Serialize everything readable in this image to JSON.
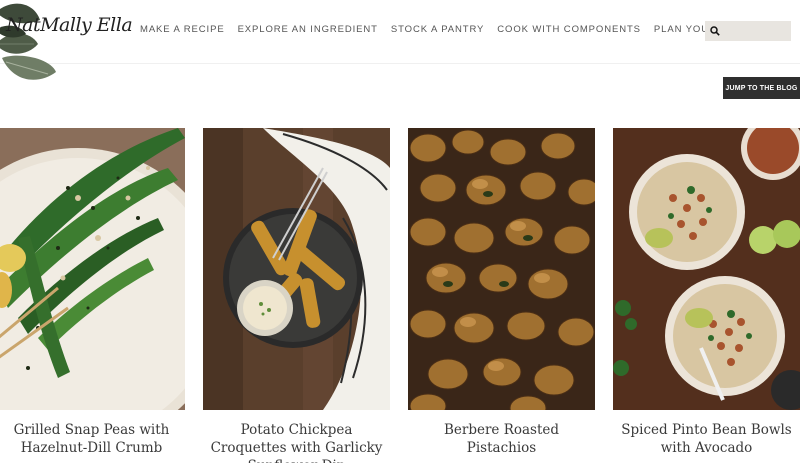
{
  "brand": {
    "logo_text": "NatMally Ella"
  },
  "nav": {
    "items": [
      {
        "label": "MAKE A RECIPE"
      },
      {
        "label": "EXPLORE AN INGREDIENT"
      },
      {
        "label": "STOCK A PANTRY"
      },
      {
        "label": "COOK WITH COMPONENTS"
      },
      {
        "label": "PLAN YOUR MEALS"
      }
    ]
  },
  "search": {
    "placeholder": "",
    "value": "",
    "icon": "search-icon"
  },
  "jump_button": {
    "label": "JUMP TO THE BLOG"
  },
  "recipes": [
    {
      "title": "Grilled Snap Peas with Hazelnut-Dill Crumb",
      "image": "snap-peas-photo"
    },
    {
      "title": "Potato Chickpea Croquettes with Garlicky Sunflower Dip",
      "image": "croquettes-photo"
    },
    {
      "title": "Berbere Roasted Pistachios",
      "image": "pistachios-photo"
    },
    {
      "title": "Spiced Pinto Bean Bowls with Avocado",
      "image": "pinto-bowls-photo"
    }
  ],
  "colors": {
    "button_bg": "#2f2f2f",
    "search_bg": "#e8e5e0",
    "text": "#3a3a3a"
  }
}
